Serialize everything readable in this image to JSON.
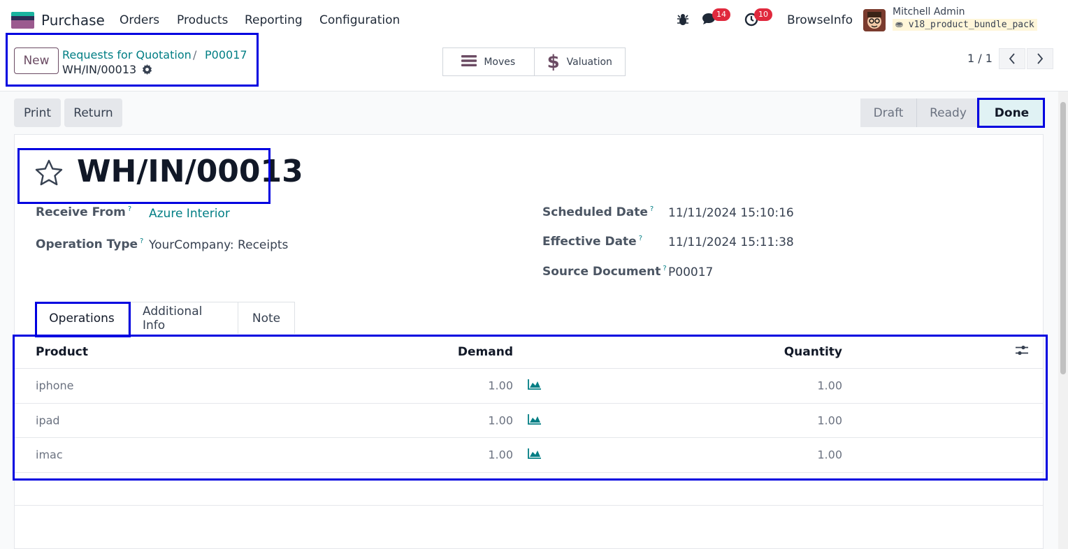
{
  "navbar": {
    "app_name": "Purchase",
    "menu": [
      "Orders",
      "Products",
      "Reporting",
      "Configuration"
    ],
    "messages_count": "14",
    "activities_count": "10",
    "company": "BrowseInfo",
    "user_name": "Mitchell Admin",
    "database": "v18_product_bundle_pack"
  },
  "control_panel": {
    "new_label": "New",
    "breadcrumb": [
      "Requests for Quotation",
      "P00017"
    ],
    "breadcrumb_sep": "/",
    "record_name": "WH/IN/00013",
    "smart_buttons": [
      {
        "label": "Moves",
        "icon": "list-icon"
      },
      {
        "label": "Valuation",
        "icon": "dollar-icon"
      }
    ],
    "pager": "1 / 1"
  },
  "actions": {
    "print_label": "Print",
    "return_label": "Return"
  },
  "statusbar": {
    "steps": [
      "Draft",
      "Ready",
      "Done"
    ],
    "active": "Done"
  },
  "form": {
    "title": "WH/IN/00013",
    "fields_left": [
      {
        "label": "Receive From",
        "value": "Azure Interior",
        "link": true
      },
      {
        "label": "Operation Type",
        "value": "YourCompany: Receipts",
        "link": false
      }
    ],
    "fields_right": [
      {
        "label": "Scheduled Date",
        "value": "11/11/2024 15:10:16"
      },
      {
        "label": "Effective Date",
        "value": "11/11/2024 15:11:38"
      },
      {
        "label": "Source Document",
        "value": "P00017"
      }
    ],
    "help_mark": "?"
  },
  "tabs": [
    "Operations",
    "Additional Info",
    "Note"
  ],
  "operations": {
    "columns": {
      "product": "Product",
      "demand": "Demand",
      "quantity": "Quantity"
    },
    "rows": [
      {
        "product": "iphone",
        "demand": "1.00",
        "quantity": "1.00"
      },
      {
        "product": "ipad",
        "demand": "1.00",
        "quantity": "1.00"
      },
      {
        "product": "imac",
        "demand": "1.00",
        "quantity": "1.00"
      }
    ]
  },
  "colors": {
    "accent": "#017e84",
    "brand": "#6b4b63",
    "highlight": "#0000e0"
  }
}
